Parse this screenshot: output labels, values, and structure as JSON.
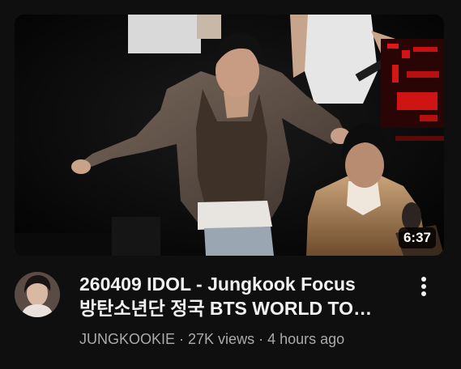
{
  "video": {
    "duration": "6:37",
    "title_line1": "260409 IDOL - Jungkook Focus",
    "title_line2": "방탄소년단 정국 BTS WORLD TO…",
    "channel": "JUNGKOOKIE",
    "sep1": " · ",
    "views": "27K views",
    "sep2": " · ",
    "age": "4 hours ago"
  },
  "icons": {
    "more": "vertical-ellipsis-icon"
  },
  "colors": {
    "background": "#0f0f0f",
    "title": "#f1f1f1",
    "secondary_text": "#aaaaaa",
    "duration_badge": "#000000"
  }
}
